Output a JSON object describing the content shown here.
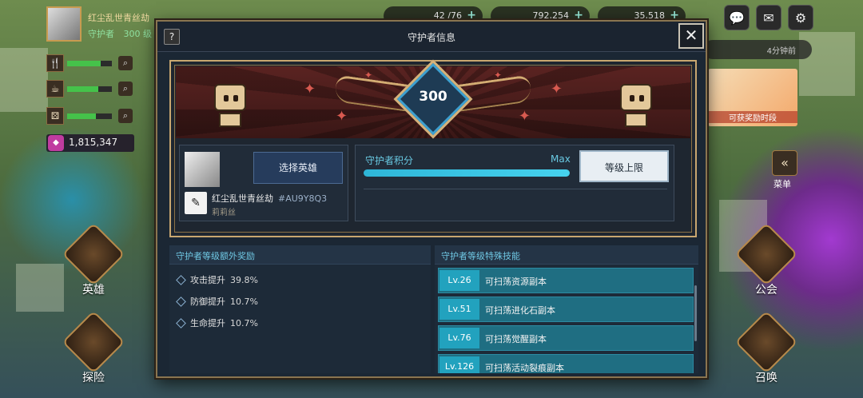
{
  "player": {
    "name": "红尘乱世青丝劫",
    "level_label": "守护者",
    "level": "300 级"
  },
  "stats": [
    {
      "icon": "fork-knife-icon",
      "glyph": "🍴",
      "fill": 0.75
    },
    {
      "icon": "cup-icon",
      "glyph": "☕",
      "fill": 0.7
    },
    {
      "icon": "dice-icon",
      "glyph": "⚄",
      "fill": 0.65
    }
  ],
  "gems": "1,815,347",
  "top_resources": [
    {
      "icon": "stamina-icon",
      "value": "42 /76"
    },
    {
      "icon": "gold-coin-icon",
      "value": "792,254"
    },
    {
      "icon": "blue-gem-icon",
      "value": "35,518"
    }
  ],
  "timer": "4分钟前",
  "news_caption": "可获奖励时段",
  "menu_label": "菜单",
  "side_buttons": {
    "hero": "英雄",
    "explore": "探险",
    "guild": "公会",
    "summon": "召唤"
  },
  "modal": {
    "title": "守护者信息",
    "help": "?",
    "close": "✕",
    "level_badge": "300",
    "hero": {
      "select_button": "选择英雄",
      "name": "红尘乱世青丝劫",
      "id": "#AU9Y8Q3",
      "subtitle": "莉莉丝"
    },
    "score": {
      "label": "守护者积分",
      "max_label": "Max",
      "progress": 1.0,
      "cap_button": "等级上限"
    },
    "bonus_panel": {
      "title": "守护者等级额外奖励",
      "items": [
        {
          "name": "攻击提升",
          "value": "39.8%"
        },
        {
          "name": "防御提升",
          "value": "10.7%"
        },
        {
          "name": "生命提升",
          "value": "10.7%"
        }
      ]
    },
    "skill_panel": {
      "title": "守护者等级特殊技能",
      "items": [
        {
          "level": "Lv.26",
          "text": "可扫荡资源副本"
        },
        {
          "level": "Lv.51",
          "text": "可扫荡进化石副本"
        },
        {
          "level": "Lv.76",
          "text": "可扫荡觉醒副本"
        },
        {
          "level": "Lv.126",
          "text": "可扫荡活动裂痕副本"
        }
      ]
    }
  }
}
